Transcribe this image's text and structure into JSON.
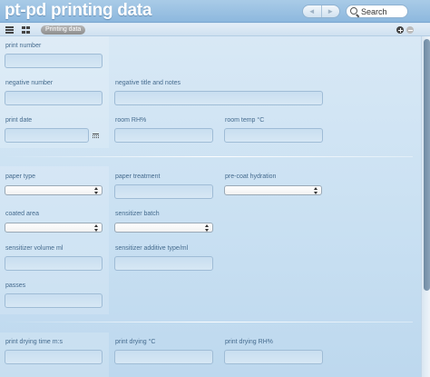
{
  "window": {
    "title": "pt-pd printing data"
  },
  "nav": {
    "back": "◄",
    "forward": "►"
  },
  "search": {
    "placeholder": "Search"
  },
  "toolbar": {
    "breadcrumb": "Printing data"
  },
  "fields": {
    "print_number": "print number",
    "negative_number": "negative number",
    "negative_title": "negative title and notes",
    "print_date": "print date",
    "room_rh": "room RH%",
    "room_temp": "room temp °C",
    "paper_type": "paper type",
    "paper_treatment": "paper treatment",
    "pre_coat_hydration": "pre-coat hydration",
    "coated_area": "coated area",
    "sensitizer_batch": "sensitizer batch",
    "sensitizer_volume": "sensitizer volume ml",
    "sensitizer_additive": "sensitizer additive type/ml",
    "passes": "passes",
    "print_drying_time": "print drying time m:s",
    "print_drying_c": "print drying °C",
    "print_drying_rh": "print drying RH%"
  }
}
